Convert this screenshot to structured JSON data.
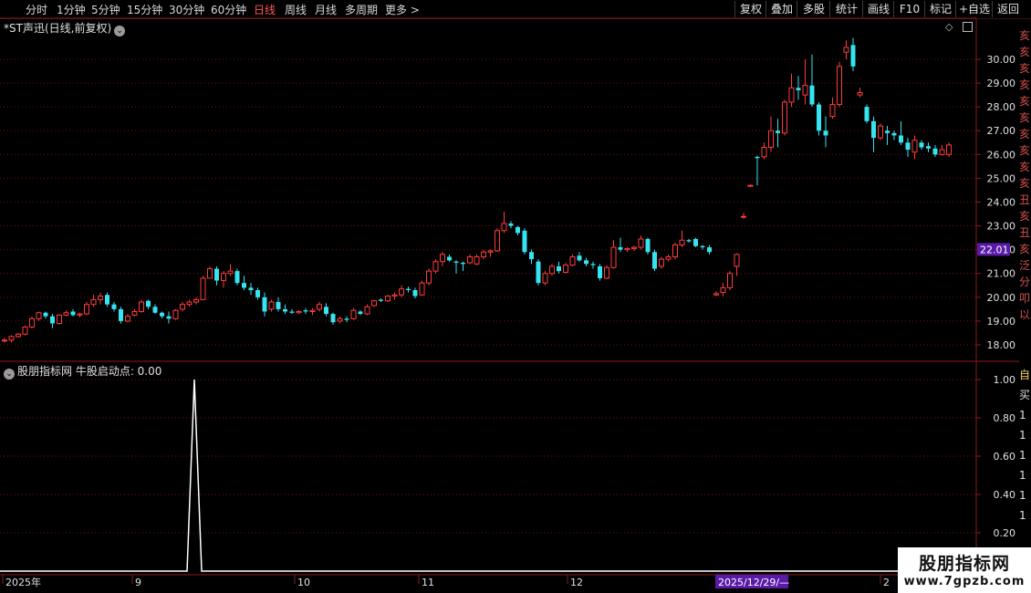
{
  "periods": [
    "分时",
    "1分钟",
    "5分钟",
    "15分钟",
    "30分钟",
    "60分钟",
    "日线",
    "周线",
    "月线",
    "多周期",
    "更多 >"
  ],
  "active_period": "日线",
  "toolbar": [
    "复权",
    "叠加",
    "多股",
    "统计",
    "画线",
    "F10",
    "标记",
    "+自选",
    "返回"
  ],
  "main_title": "*ST声迅(日线,前复权)",
  "indicator_title": "股朋指标网  牛股启动点: 0.00",
  "price_axis": [
    "30.00",
    "29.00",
    "28.00",
    "27.00",
    "26.00",
    "25.00",
    "24.00",
    "23.00",
    "22.00",
    "21.00",
    "20.00",
    "19.00",
    "18.00"
  ],
  "price_highlight": "22.01",
  "indicator_axis": [
    "1.00",
    "0.80",
    "0.60",
    "0.40",
    "0.20"
  ],
  "date_axis": [
    "2025年",
    "9",
    "10",
    "11",
    "12",
    "2"
  ],
  "date_highlight": "2025/12/29/—",
  "right_panel_text": "亥亥亥亥亥亥亥亥亥亥丑亥丑亥泛分叩以",
  "right_panel_values": [
    "自",
    "买",
    "1",
    "1",
    "1",
    "1",
    "1",
    "1",
    "1"
  ],
  "watermark": {
    "name": "股朋指标网",
    "url": "www.7gpzb.com"
  },
  "colors": {
    "up": "#ff3b3b",
    "down": "#35e4f0",
    "grid": "#6b1414",
    "axis": "#8b1a1a",
    "highlight": "#5a1aa8"
  },
  "candles": [
    [
      18.2,
      18.3,
      18.1,
      18.2
    ],
    [
      18.2,
      18.4,
      18.1,
      18.35
    ],
    [
      18.35,
      18.5,
      18.3,
      18.45
    ],
    [
      18.45,
      18.8,
      18.4,
      18.75
    ],
    [
      18.75,
      19.2,
      18.7,
      19.1
    ],
    [
      19.1,
      19.4,
      19.0,
      19.35
    ],
    [
      19.35,
      19.4,
      19.1,
      19.2
    ],
    [
      19.2,
      19.3,
      18.7,
      18.9
    ],
    [
      18.9,
      19.3,
      18.85,
      19.25
    ],
    [
      19.25,
      19.45,
      19.2,
      19.35
    ],
    [
      19.4,
      19.5,
      19.2,
      19.25
    ],
    [
      19.25,
      19.35,
      19.15,
      19.3
    ],
    [
      19.3,
      19.8,
      19.25,
      19.7
    ],
    [
      19.7,
      20.1,
      19.6,
      19.9
    ],
    [
      19.9,
      20.2,
      19.7,
      20.05
    ],
    [
      20.1,
      20.2,
      19.6,
      19.7
    ],
    [
      19.7,
      19.8,
      19.4,
      19.5
    ],
    [
      19.5,
      19.6,
      18.9,
      19.0
    ],
    [
      19.0,
      19.3,
      18.95,
      19.2
    ],
    [
      19.25,
      19.5,
      19.2,
      19.4
    ],
    [
      19.4,
      19.9,
      19.35,
      19.8
    ],
    [
      19.85,
      19.9,
      19.5,
      19.6
    ],
    [
      19.6,
      19.7,
      19.3,
      19.35
    ],
    [
      19.35,
      19.4,
      19.1,
      19.2
    ],
    [
      19.2,
      19.4,
      18.9,
      19.1
    ],
    [
      19.1,
      19.5,
      19.05,
      19.45
    ],
    [
      19.5,
      19.8,
      19.4,
      19.7
    ],
    [
      19.7,
      19.9,
      19.6,
      19.8
    ],
    [
      19.8,
      20.0,
      19.7,
      19.9
    ],
    [
      19.9,
      20.9,
      19.9,
      20.8
    ],
    [
      20.8,
      21.3,
      20.8,
      21.2
    ],
    [
      21.2,
      21.3,
      20.5,
      20.7
    ],
    [
      20.7,
      21.1,
      20.4,
      21.0
    ],
    [
      21.0,
      21.4,
      20.9,
      21.1
    ],
    [
      21.1,
      21.2,
      20.5,
      20.6
    ],
    [
      20.6,
      20.9,
      20.3,
      20.4
    ],
    [
      20.4,
      20.6,
      20.1,
      20.3
    ],
    [
      20.3,
      20.4,
      19.9,
      20.0
    ],
    [
      20.0,
      20.2,
      19.2,
      19.4
    ],
    [
      19.5,
      19.9,
      19.4,
      19.8
    ],
    [
      19.8,
      20.0,
      19.4,
      19.5
    ],
    [
      19.5,
      19.7,
      19.3,
      19.4
    ],
    [
      19.4,
      19.5,
      19.3,
      19.35
    ],
    [
      19.35,
      19.45,
      19.3,
      19.4
    ],
    [
      19.45,
      19.55,
      19.3,
      19.4
    ],
    [
      19.4,
      19.55,
      19.25,
      19.45
    ],
    [
      19.5,
      19.8,
      19.4,
      19.7
    ],
    [
      19.6,
      19.75,
      19.2,
      19.3
    ],
    [
      19.3,
      19.35,
      18.85,
      18.95
    ],
    [
      19.0,
      19.2,
      18.9,
      19.1
    ],
    [
      19.1,
      19.2,
      18.95,
      19.05
    ],
    [
      19.1,
      19.55,
      19.05,
      19.45
    ],
    [
      19.4,
      19.45,
      19.25,
      19.3
    ],
    [
      19.3,
      19.7,
      19.25,
      19.6
    ],
    [
      19.65,
      19.9,
      19.6,
      19.85
    ],
    [
      19.9,
      19.95,
      19.8,
      19.85
    ],
    [
      19.85,
      20.1,
      19.8,
      20.05
    ],
    [
      20.05,
      20.2,
      19.9,
      20.1
    ],
    [
      20.1,
      20.5,
      20.0,
      20.35
    ],
    [
      20.35,
      20.45,
      20.2,
      20.3
    ],
    [
      20.3,
      20.4,
      19.95,
      20.05
    ],
    [
      20.1,
      20.7,
      20.05,
      20.6
    ],
    [
      20.6,
      21.2,
      20.5,
      21.1
    ],
    [
      21.1,
      21.6,
      21.0,
      21.5
    ],
    [
      21.5,
      21.9,
      21.3,
      21.8
    ],
    [
      21.7,
      21.8,
      21.5,
      21.55
    ],
    [
      21.5,
      21.55,
      21.0,
      21.45
    ],
    [
      21.45,
      21.5,
      21.1,
      21.4
    ],
    [
      21.45,
      21.8,
      21.4,
      21.7
    ],
    [
      21.4,
      21.8,
      21.35,
      21.7
    ],
    [
      21.7,
      22.0,
      21.6,
      21.9
    ],
    [
      21.9,
      22.0,
      21.7,
      21.95
    ],
    [
      21.95,
      22.9,
      21.9,
      22.8
    ],
    [
      22.8,
      23.6,
      22.7,
      23.1
    ],
    [
      23.1,
      23.2,
      22.9,
      23.0
    ],
    [
      22.95,
      23.0,
      22.6,
      22.7
    ],
    [
      22.8,
      22.9,
      21.8,
      21.9
    ],
    [
      21.9,
      22.0,
      21.4,
      21.6
    ],
    [
      21.5,
      21.6,
      20.5,
      20.6
    ],
    [
      20.6,
      21.1,
      20.5,
      21.0
    ],
    [
      21.0,
      21.4,
      20.9,
      21.3
    ],
    [
      21.3,
      21.5,
      21.0,
      21.1
    ],
    [
      21.05,
      21.45,
      21.0,
      21.35
    ],
    [
      21.35,
      21.8,
      21.3,
      21.7
    ],
    [
      21.75,
      21.9,
      21.5,
      21.55
    ],
    [
      21.55,
      21.65,
      21.3,
      21.4
    ],
    [
      21.4,
      21.5,
      21.2,
      21.35
    ],
    [
      21.3,
      21.4,
      20.7,
      20.8
    ],
    [
      20.8,
      21.35,
      20.75,
      21.25
    ],
    [
      21.25,
      22.4,
      21.2,
      22.1
    ],
    [
      22.1,
      22.5,
      21.9,
      22.0
    ],
    [
      22.0,
      22.1,
      21.9,
      22.05
    ],
    [
      22.05,
      22.15,
      21.95,
      22.1
    ],
    [
      22.1,
      22.6,
      22.0,
      22.45
    ],
    [
      22.45,
      22.5,
      21.8,
      21.9
    ],
    [
      21.9,
      22.0,
      21.1,
      21.2
    ],
    [
      21.3,
      21.7,
      21.2,
      21.6
    ],
    [
      21.6,
      21.8,
      21.5,
      21.7
    ],
    [
      21.7,
      22.3,
      21.6,
      22.2
    ],
    [
      22.2,
      22.8,
      22.1,
      22.4
    ],
    [
      22.4,
      22.45,
      22.3,
      22.35
    ],
    [
      22.45,
      22.5,
      22.1,
      22.15
    ],
    [
      22.15,
      22.2,
      22.0,
      22.1
    ],
    [
      22.1,
      22.2,
      21.8,
      21.9
    ],
    [
      20.1,
      20.25,
      20.05,
      20.15
    ],
    [
      20.2,
      20.6,
      20.05,
      20.4
    ],
    [
      20.4,
      21.1,
      20.3,
      21.0
    ],
    [
      21.3,
      21.85,
      20.9,
      21.8
    ],
    [
      23.4,
      23.55,
      23.3,
      23.4
    ],
    [
      24.7,
      24.75,
      24.65,
      24.7
    ],
    [
      25.9,
      25.95,
      24.7,
      25.85
    ],
    [
      25.9,
      26.5,
      25.8,
      26.3
    ],
    [
      26.3,
      27.6,
      26.1,
      27.0
    ],
    [
      27.0,
      27.5,
      26.3,
      26.9
    ],
    [
      26.9,
      28.3,
      26.8,
      28.2
    ],
    [
      28.2,
      29.4,
      28.0,
      28.8
    ],
    [
      28.8,
      29.3,
      28.3,
      28.7
    ],
    [
      28.5,
      30.0,
      28.1,
      28.9
    ],
    [
      28.9,
      30.2,
      28.0,
      28.1
    ],
    [
      28.1,
      28.2,
      26.8,
      27.0
    ],
    [
      27.0,
      27.6,
      26.3,
      26.8
    ],
    [
      27.6,
      28.4,
      27.5,
      28.1
    ],
    [
      28.1,
      29.9,
      28.0,
      29.7
    ],
    [
      30.3,
      30.8,
      30.0,
      30.5
    ],
    [
      30.6,
      30.9,
      29.5,
      29.7
    ],
    [
      28.5,
      28.8,
      28.4,
      28.6
    ],
    [
      28.0,
      28.1,
      27.3,
      27.4
    ],
    [
      27.4,
      27.6,
      26.1,
      26.7
    ],
    [
      26.7,
      27.3,
      26.6,
      27.2
    ],
    [
      27.0,
      27.2,
      26.4,
      26.9
    ],
    [
      26.9,
      27.0,
      26.6,
      26.8
    ],
    [
      26.8,
      27.4,
      26.4,
      26.5
    ],
    [
      26.5,
      26.7,
      25.9,
      26.2
    ],
    [
      26.1,
      26.8,
      25.8,
      26.6
    ],
    [
      26.5,
      26.6,
      26.2,
      26.3
    ],
    [
      26.35,
      26.5,
      26.1,
      26.25
    ],
    [
      26.25,
      26.4,
      25.9,
      26.0
    ],
    [
      26.0,
      26.4,
      25.95,
      26.2
    ],
    [
      26.0,
      26.5,
      25.9,
      26.4
    ]
  ]
}
